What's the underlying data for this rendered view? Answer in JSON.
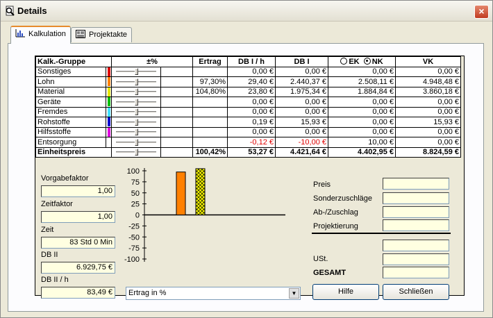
{
  "window": {
    "title": "Details",
    "close_label": "×"
  },
  "tabs": [
    {
      "label": "Kalkulation"
    },
    {
      "label": "Projektakte"
    }
  ],
  "grid": {
    "headers": {
      "gruppe": "Kalk.-Gruppe",
      "pm": "±%",
      "ertrag": "Ertrag",
      "db1h": "DB I / h",
      "db1": "DB I",
      "ek": "EK",
      "nk": "NK",
      "vk": "VK"
    },
    "rows": [
      {
        "name": "Sonstiges",
        "color": "#e00000",
        "slider": 0.5,
        "ertrag": "",
        "db1h": "0,00 €",
        "db1": "0,00 €",
        "eknk": "0,00 €",
        "vk": "0,00 €"
      },
      {
        "name": "Lohn",
        "color": "#ff8000",
        "slider": 0.5,
        "ertrag": "97,30%",
        "db1h": "29,40 €",
        "db1": "2.440,37 €",
        "eknk": "2.508,11 €",
        "vk": "4.948,48 €"
      },
      {
        "name": "Material",
        "color": "#e6e600",
        "slider": 0.5,
        "ertrag": "104,80%",
        "db1h": "23,80 €",
        "db1": "1.975,34 €",
        "eknk": "1.884,84 €",
        "vk": "3.860,18 €"
      },
      {
        "name": "Geräte",
        "color": "#00c000",
        "slider": 0.5,
        "ertrag": "",
        "db1h": "0,00 €",
        "db1": "0,00 €",
        "eknk": "0,00 €",
        "vk": "0,00 €"
      },
      {
        "name": "Fremdes",
        "color": "#40e0ff",
        "slider": 0.5,
        "ertrag": "",
        "db1h": "0,00 €",
        "db1": "0,00 €",
        "eknk": "0,00 €",
        "vk": "0,00 €"
      },
      {
        "name": "Rohstoffe",
        "color": "#0000d0",
        "slider": 0.5,
        "ertrag": "",
        "db1h": "0,19 €",
        "db1": "15,93 €",
        "eknk": "0,00 €",
        "vk": "15,93 €"
      },
      {
        "name": "Hilfsstoffe",
        "color": "#e000e0",
        "slider": 0.5,
        "ertrag": "",
        "db1h": "0,00 €",
        "db1": "0,00 €",
        "eknk": "0,00 €",
        "vk": "0,00 €"
      },
      {
        "name": "Entsorgung",
        "color": "#ffffff",
        "slider": 0.5,
        "ertrag": "",
        "db1h": "-0,12 €",
        "db1": "-10,00 €",
        "eknk": "10,00 €",
        "vk": "0,00 €"
      }
    ],
    "total": {
      "name": "Einheitspreis",
      "slider": 0.5,
      "ertrag": "100,42%",
      "db1h": "53,27 €",
      "db1": "4.421,64 €",
      "eknk": "4.402,95 €",
      "vk": "8.824,59 €"
    }
  },
  "left": {
    "vorgabefaktor_label": "Vorgabefaktor",
    "vorgabefaktor": "1,00",
    "zeitfaktor_label": "Zeitfaktor",
    "zeitfaktor": "1,00",
    "zeit_label": "Zeit",
    "zeit": "83 Std 0 Min",
    "db2_label": "DB II",
    "db2": "6.929,75 €",
    "db2h_label": "DB II / h",
    "db2h": "83,49 €"
  },
  "chart_data": {
    "type": "bar",
    "yticks": [
      "100",
      "75",
      "50",
      "25",
      "0",
      "-25",
      "-50",
      "-75",
      "-100"
    ],
    "ylim": [
      -100,
      100
    ],
    "series": [
      {
        "values": [
          97.3
        ],
        "color": "#ff8000",
        "pattern": "solid"
      },
      {
        "values": [
          104.8
        ],
        "color": "#ffff00",
        "pattern": "crosshatch"
      }
    ]
  },
  "select": {
    "value": "Ertrag in %",
    "arrow": "▼"
  },
  "right": {
    "preis": "Preis",
    "sonderzuschlaege": "Sonderzuschläge",
    "abzuschlag": "Ab-/Zuschlag",
    "projektierung": "Projektierung",
    "ust": "USt.",
    "gesamt": "GESAMT"
  },
  "buttons": {
    "hilfe": "Hilfe",
    "schliessen": "Schließen"
  }
}
